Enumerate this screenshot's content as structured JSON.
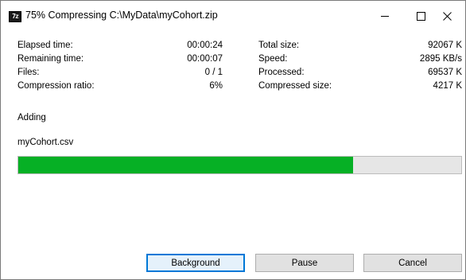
{
  "window": {
    "icon_text": "7z",
    "title": "75% Compressing C:\\MyData\\myCohort.zip"
  },
  "stats_left": [
    {
      "label": "Elapsed time:",
      "value": "00:00:24"
    },
    {
      "label": "Remaining time:",
      "value": "00:00:07"
    },
    {
      "label": "Files:",
      "value": "0 / 1"
    },
    {
      "label": "Compression ratio:",
      "value": "6%"
    }
  ],
  "stats_right": [
    {
      "label": "Total size:",
      "value": "92067 K"
    },
    {
      "label": "Speed:",
      "value": "2895 KB/s"
    },
    {
      "label": "Processed:",
      "value": "69537 K"
    },
    {
      "label": "Compressed size:",
      "value": "4217 K"
    }
  ],
  "status": "Adding",
  "current_file": "myCohort.csv",
  "progress": {
    "fraction": 0.755,
    "color": "#06b025"
  },
  "buttons": {
    "background": "Background",
    "pause": "Pause",
    "cancel": "Cancel"
  },
  "icons": {
    "minimize": "minimize-icon",
    "maximize": "maximize-icon",
    "close": "close-icon"
  },
  "colors": {
    "focus_border": "#0078d7",
    "button_bg": "#e1e1e1"
  }
}
